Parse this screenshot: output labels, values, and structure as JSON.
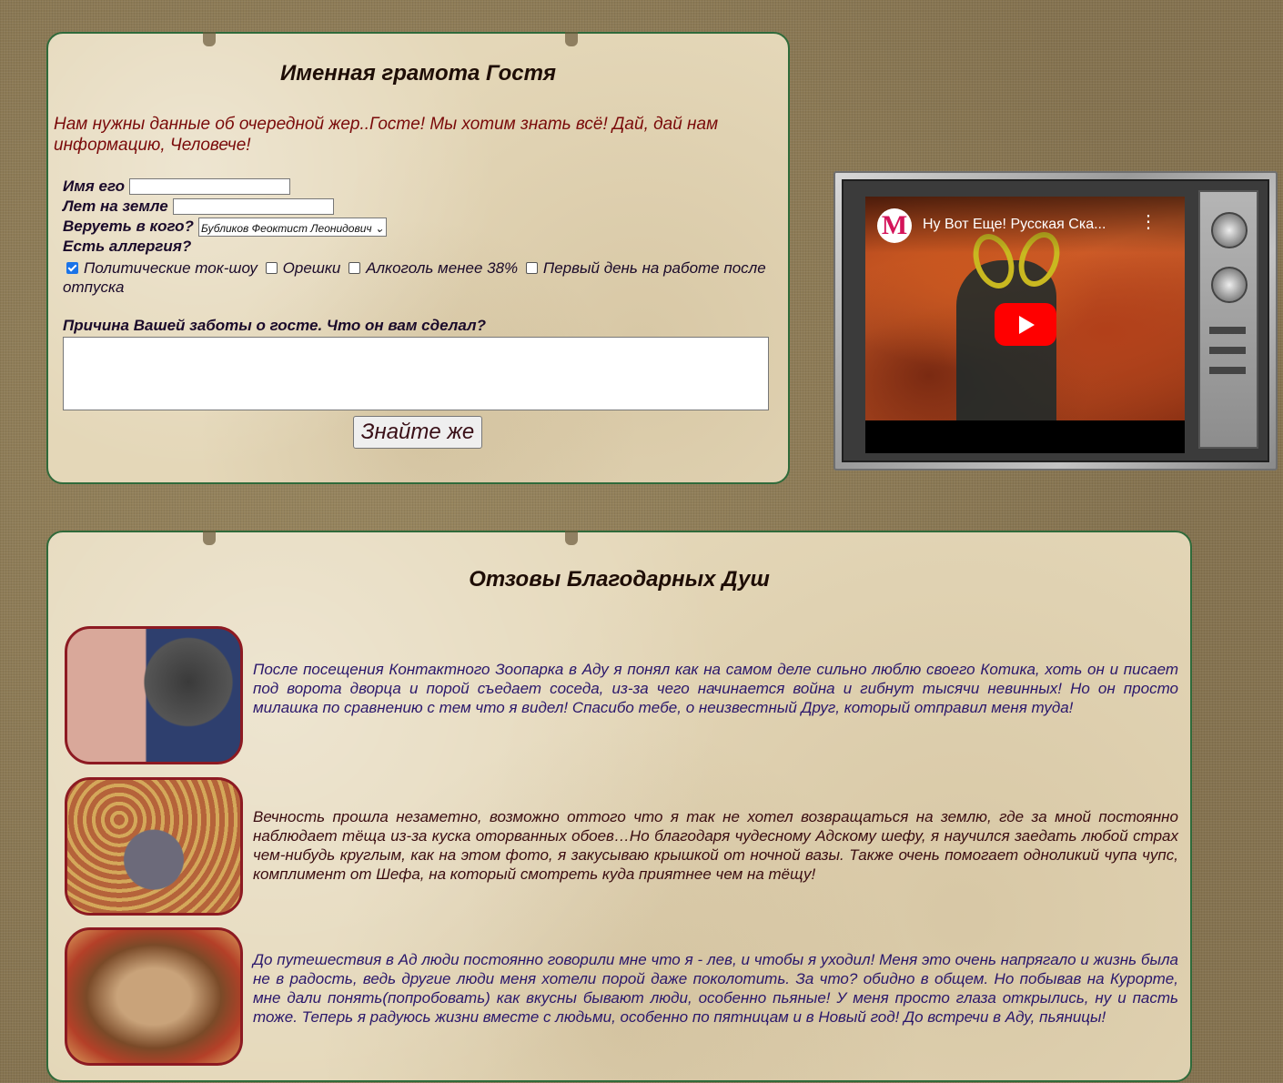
{
  "form": {
    "title": "Именная грамота Гостя",
    "intro": "Нам нужны данные об очередной жер..Госте! Мы хотим знать всё! Дай, дай нам информацию, Человече!",
    "name_label": "Имя его",
    "name_value": "",
    "age_label": "Лет на земле",
    "age_value": "",
    "faith_label": "Веруеть в кого?",
    "faith_selected": "Бубликов Феоктист Леонидович",
    "allergy_label": "Есть аллергия?",
    "allergies": [
      {
        "label": "Политические ток-шоу",
        "checked": true
      },
      {
        "label": "Орешки",
        "checked": false
      },
      {
        "label": "Алкоголь менее 38%",
        "checked": false
      },
      {
        "label": "Первый день на работе после отпуска",
        "checked": false
      }
    ],
    "reason_label": "Причина Вашей заботы о госте. Что он вам сделал?",
    "reason_value": "",
    "submit_label": "Знайте же"
  },
  "video": {
    "title": "Ну Вот Еще! Русская Ска...",
    "channel_logo": "М",
    "kebab": "⋮"
  },
  "reviews": {
    "title": "Отзовы Благодарных Душ",
    "items": [
      {
        "text": "После посещения Контактного Зоопарка в Аду я понял как на самом деле сильно люблю своего Котика, хоть он и писает под ворота дворца и порой съедает соседа, из-за чего начинается война и гибнут тысячи невинных! Но он просто милашка по сравнению с тем что я видел! Спасибо тебе, о неизвестный Друг, который отправил меня туда!",
        "color": "#2a176b"
      },
      {
        "text": "Вечность прошла незаметно, возможно оттого что я так не хотел возвращаться на землю, где за мной постоянно наблюдает тёща из-за куска оторванных обоев…Но благодаря чудесному Адскому шефу, я научился заедать любой страх чем-нибудь круглым, как на этом фото, я закусываю крышкой от ночной вазы. Также очень помогает одноликий чупа чупс, комплимент от Шефа, на который смотреть куда приятнее чем на тёщу!",
        "color": "#3a0c10"
      },
      {
        "text": "До путешествия в Ад люди постоянно говорили мне что я - лев, и чтобы я уходил! Меня это очень напрягало и жизнь была не в радость, ведь другие люди меня хотели порой даже поколотить. За что? обидно в общем. Но побывав на Курорте, мне дали понять(попробовать) как вкусны бывают люди, особенно пьяные! У меня просто глаза открылись, ну и пасть тоже. Теперь я радуюсь жизни вместе с людьми, особенно по пятницам и в Новый год! До встречи в Аду, пьяницы!",
        "color": "#2a176b"
      }
    ]
  }
}
